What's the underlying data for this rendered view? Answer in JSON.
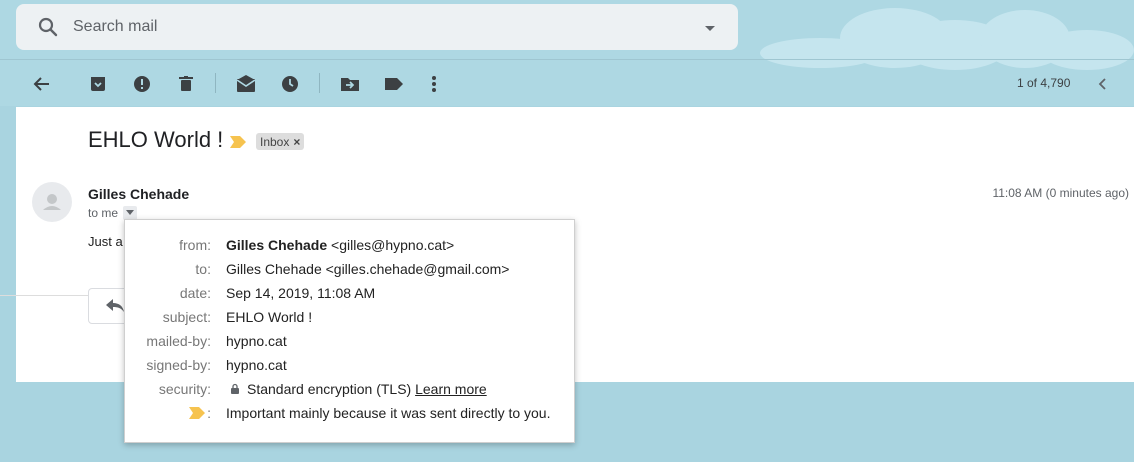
{
  "search": {
    "placeholder": "Search mail"
  },
  "toolbar": {
    "pager": "1 of 4,790",
    "icons": [
      "back-arrow-icon",
      "archive-icon",
      "report-spam-icon",
      "delete-icon",
      "mark-unread-icon",
      "snooze-icon",
      "move-to-icon",
      "labels-icon",
      "more-vert-icon",
      "prev-chevron-icon"
    ]
  },
  "message": {
    "subject": "EHLO World !",
    "label_chip": "Inbox",
    "label_chip_close": "×",
    "sender": "Gilles Chehade",
    "to_me": "to me",
    "timestamp": "11:08 AM (0 minutes ago)",
    "snippet": "Just a"
  },
  "details": {
    "from_label": "from:",
    "from_name": "Gilles Chehade",
    "from_email": " <gilles@hypno.cat>",
    "to_label": "to:",
    "to_value": "Gilles Chehade <gilles.chehade@gmail.com>",
    "date_label": "date:",
    "date_value": "Sep 14, 2019, 11:08 AM",
    "subject_label": "subject:",
    "subject_value": "EHLO World !",
    "mailedby_label": "mailed-by:",
    "mailedby_value": "hypno.cat",
    "signedby_label": "signed-by:",
    "signedby_value": "hypno.cat",
    "security_label": "security:",
    "security_value": "Standard encryption (TLS)",
    "security_link": "Learn more",
    "importance_label": ":",
    "importance_value": "Important mainly because it was sent directly to you."
  },
  "colors": {
    "background": "#a9d4e0",
    "importance_marker": "#f6c34f"
  }
}
